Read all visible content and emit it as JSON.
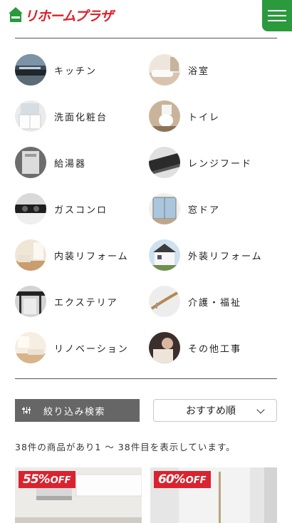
{
  "header": {
    "logo_text": "リホームプラザ",
    "menu_icon": "hamburger-menu-icon",
    "accent_color": "#2a9a3c",
    "brand_color": "#e0202a"
  },
  "categories": [
    {
      "label": "キッチン",
      "icon": "kitchen-photo"
    },
    {
      "label": "浴室",
      "icon": "bathroom-photo"
    },
    {
      "label": "洗面化粧台",
      "icon": "vanity-photo"
    },
    {
      "label": "トイレ",
      "icon": "toilet-photo"
    },
    {
      "label": "給湯器",
      "icon": "water-heater-photo"
    },
    {
      "label": "レンジフード",
      "icon": "range-hood-photo"
    },
    {
      "label": "ガスコンロ",
      "icon": "gas-stove-photo"
    },
    {
      "label": "窓ドア",
      "icon": "window-door-photo"
    },
    {
      "label": "内装リフォーム",
      "icon": "interior-photo"
    },
    {
      "label": "外装リフォーム",
      "icon": "exterior-photo"
    },
    {
      "label": "エクステリア",
      "icon": "exterior-structure-photo"
    },
    {
      "label": "介護・福祉",
      "icon": "handrail-photo"
    },
    {
      "label": "リノベーション",
      "icon": "renovation-photo"
    },
    {
      "label": "その他工事",
      "icon": "other-work-photo"
    }
  ],
  "filter": {
    "label": "絞り込み検索",
    "icon": "filter-sliders-icon"
  },
  "sort": {
    "selected": "おすすめ順",
    "icon": "chevron-down-icon"
  },
  "results": {
    "text": "38件の商品があり1 〜 38件目を表示しています。"
  },
  "products": [
    {
      "discount_pct": "55%",
      "discount_off": "OFF"
    },
    {
      "discount_pct": "60%",
      "discount_off": "OFF"
    }
  ]
}
